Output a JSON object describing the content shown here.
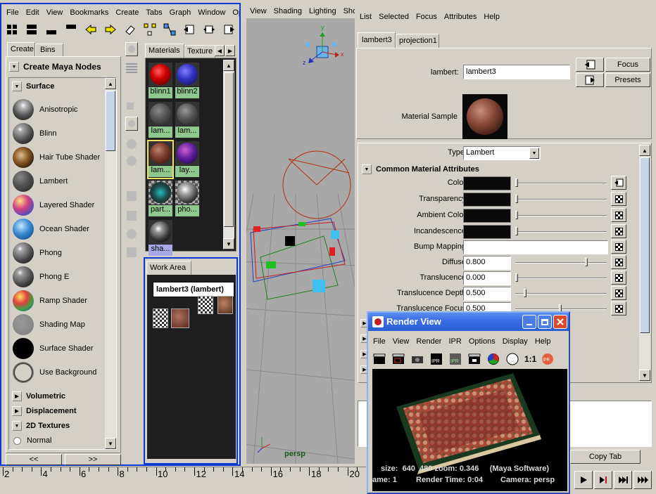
{
  "left_panel": {
    "menu": [
      "File",
      "Edit",
      "View",
      "Bookmarks",
      "Create",
      "Tabs",
      "Graph",
      "Window",
      "Optio"
    ],
    "tabs": {
      "create": "Create",
      "bins": "Bins"
    },
    "create_header": "Create Maya Nodes",
    "surface_label": "Surface",
    "surface_items": [
      "Anisotropic",
      "Blinn",
      "Hair Tube Shader",
      "Lambert",
      "Layered Shader",
      "Ocean Shader",
      "Phong",
      "Phong E",
      "Ramp Shader",
      "Shading Map",
      "Surface Shader",
      "Use Background"
    ],
    "more_sections": [
      "Volumetric",
      "Displacement",
      "2D Textures"
    ],
    "radio_label": "Normal",
    "nav_left": "<<",
    "nav_right": ">>",
    "mat_tabs": {
      "materials": "Materials",
      "textures": "Texture"
    },
    "materials": [
      "blinn1",
      "blinn2",
      "lam...",
      "lam...",
      "lam...",
      "lay...",
      "part...",
      "pho...",
      "sha..."
    ],
    "work_area_tab": "Work Area",
    "work_node": "lambert3 (lambert)"
  },
  "viewport": {
    "menu": [
      "View",
      "Shading",
      "Lighting",
      "Sho"
    ],
    "camera_label": "persp",
    "axis_x": "x",
    "axis_y": "y",
    "axis_z": "z"
  },
  "attr_editor": {
    "menu": [
      "List",
      "Selected",
      "Focus",
      "Attributes",
      "Help"
    ],
    "tabs": {
      "lambert3": "lambert3",
      "projection1": "projection1"
    },
    "lambert_label": "lambert:",
    "lambert_value": "lambert3",
    "focus_btn": "Focus",
    "presets_btn": "Presets",
    "material_sample_label": "Material Sample",
    "type_label": "Type",
    "type_value": "Lambert",
    "section_title": "Common Material Attributes",
    "color_attrs": [
      {
        "label": "Color"
      },
      {
        "label": "Transparency"
      },
      {
        "label": "Ambient Color"
      },
      {
        "label": "Incandescence"
      }
    ],
    "bump_label": "Bump Mapping",
    "num_attrs": [
      {
        "label": "Diffuse",
        "value": "0.800",
        "level": 0.8
      },
      {
        "label": "Translucence",
        "value": "0.000",
        "level": 0.0
      },
      {
        "label": "Translucence Depth",
        "value": "0.500",
        "level": 0.1
      },
      {
        "label": "Translucence Focus",
        "value": "0.500",
        "level": 0.5
      }
    ],
    "copy_tab": "Copy Tab"
  },
  "render_view": {
    "title": "Render View",
    "menu": [
      "File",
      "View",
      "Render",
      "IPR",
      "Options",
      "Display",
      "Help"
    ],
    "ratio": "1:1",
    "status_line1": "size:  640  480 zoom: 0.346     (Maya Software)",
    "status_frame": "ame: 1",
    "status_time": "Render Time: 0:04",
    "status_camera": "Camera: persp"
  },
  "timeline": {
    "ticks": [
      "2",
      "4",
      "6",
      "8",
      "10",
      "12",
      "14",
      "16",
      "18",
      "20"
    ]
  },
  "colors": {
    "panel_bg": "#d4d0c8",
    "dark_panel": "#1e1e1e",
    "viewport_bg": "#a8a8a8",
    "selection_blue": "#0a3ad6",
    "label_green": "#8fc88f",
    "title_blue": "#3a6ee8"
  }
}
